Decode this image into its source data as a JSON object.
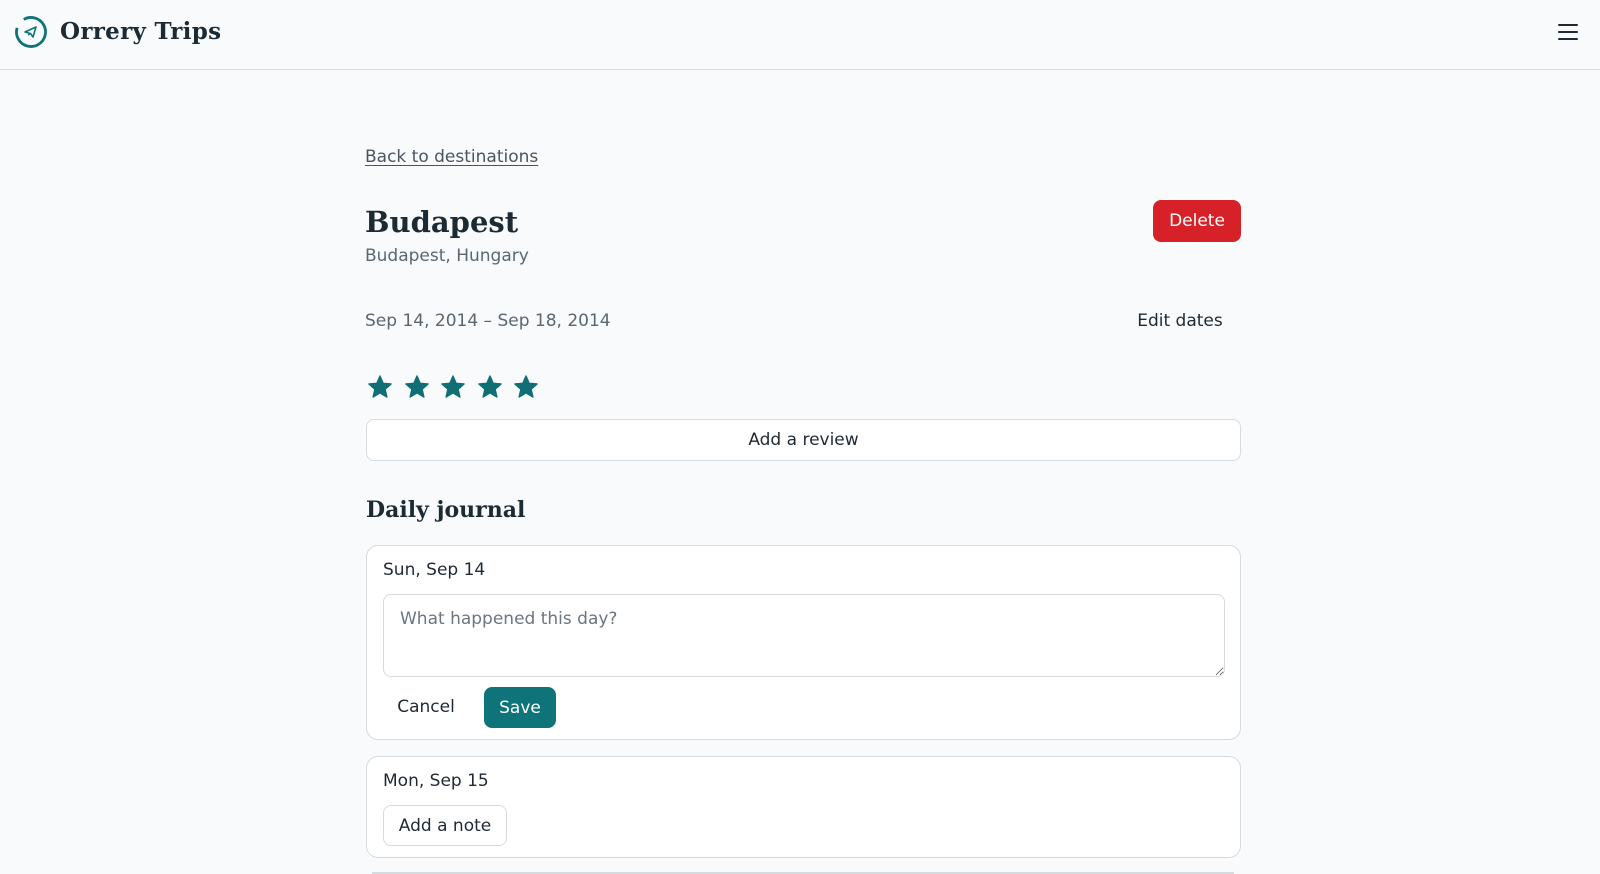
{
  "app": {
    "name": "Orrery Trips"
  },
  "header": {
    "logo_icon": "globe-plane-icon",
    "menu_icon": "hamburger-menu-icon"
  },
  "navigation": {
    "back_label": "Back to destinations"
  },
  "destination": {
    "title": "Budapest",
    "location": "Budapest, Hungary",
    "date_range": "Sep 14, 2014 – Sep 18, 2014",
    "rating": 5,
    "rating_max": 5
  },
  "actions": {
    "delete_label": "Delete",
    "edit_dates_label": "Edit dates",
    "add_review_label": "Add a review"
  },
  "journal": {
    "heading": "Daily journal",
    "days": [
      {
        "label": "Sun, Sep 14",
        "placeholder": "What happened this day?",
        "cancel_label": "Cancel",
        "save_label": "Save"
      },
      {
        "label": "Mon, Sep 15",
        "add_note_label": "Add a note"
      }
    ]
  },
  "colors": {
    "accent": "#0f7479",
    "danger": "#d72129",
    "background": "#f8fafc",
    "star": "#0f6f75"
  }
}
